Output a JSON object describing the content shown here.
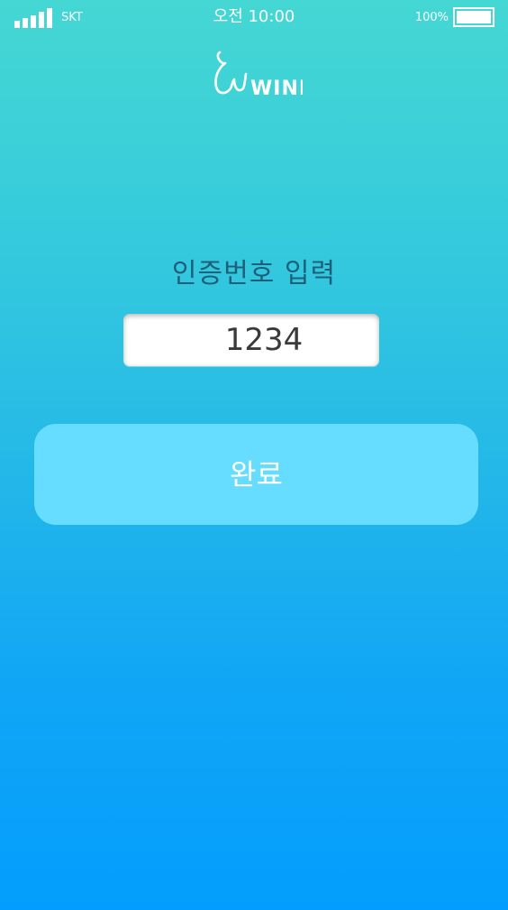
{
  "status_bar": {
    "carrier": "SKT",
    "time": "오전 10:00",
    "battery_percent": "100%",
    "battery_level": 1.0,
    "signal_icon": "signal-bars-icon"
  },
  "logo": {
    "text": "WIND",
    "icon": "wind-logo"
  },
  "form": {
    "title": "인증번호 입력",
    "code_value": "1234"
  },
  "actions": {
    "done_label": "완료"
  },
  "colors": {
    "background_top": "#45d7d3",
    "background_bottom": "#039dfd",
    "button": "#66ddff",
    "title_text": "#1f5f79"
  }
}
